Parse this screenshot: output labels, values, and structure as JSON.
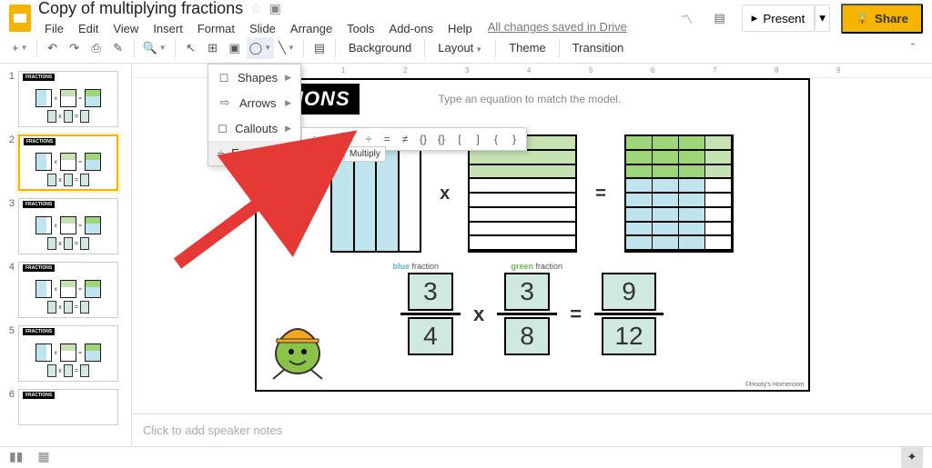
{
  "header": {
    "doc_title": "Copy of multiplying fractions",
    "saved_status": "All changes saved in Drive",
    "present_label": "Present",
    "share_label": "Share",
    "menus": [
      "File",
      "Edit",
      "View",
      "Insert",
      "Format",
      "Slide",
      "Arrange",
      "Tools",
      "Add-ons",
      "Help"
    ]
  },
  "toolbar": {
    "background": "Background",
    "layout": "Layout",
    "theme": "Theme",
    "transition": "Transition"
  },
  "shape_menu": {
    "items": [
      {
        "icon": "◻",
        "label": "Shapes"
      },
      {
        "icon": "→",
        "label": "Arrows"
      },
      {
        "icon": "▭",
        "label": "Callouts"
      },
      {
        "icon": "÷",
        "label": "Equation"
      }
    ]
  },
  "equation_submenu": [
    "÷",
    "−",
    "×",
    "÷",
    "=",
    "≠",
    "{}",
    "{}",
    "[",
    "]",
    "{",
    "}"
  ],
  "tooltip": "Multiply",
  "thumbs": {
    "title": "FRACTIONS",
    "slides": [
      {
        "n": "1",
        "eq": [
          "1",
          "4",
          "1",
          "3",
          "1",
          "12"
        ]
      },
      {
        "n": "2",
        "eq": [
          "3",
          "4",
          "3",
          "8",
          "9",
          "12"
        ],
        "selected": true
      },
      {
        "n": "3",
        "eq": [
          "",
          "",
          "",
          "",
          "",
          ""
        ]
      },
      {
        "n": "4",
        "eq": [
          "",
          "",
          "",
          "",
          "",
          ""
        ]
      },
      {
        "n": "5",
        "eq": [
          "",
          "",
          "",
          "",
          "",
          ""
        ]
      },
      {
        "n": "6",
        "eq": [
          "",
          "",
          "",
          "",
          "",
          ""
        ]
      }
    ]
  },
  "slide": {
    "title": "CTIONS",
    "prompt": "Type an equation to match the model.",
    "blue_label_1": "blue",
    "blue_label_2": " fraction",
    "green_label_1": "green",
    "green_label_2": " fraction",
    "op_times": "x",
    "op_equals": "=",
    "fractions": {
      "a_num": "3",
      "a_den": "4",
      "b_num": "3",
      "b_den": "8",
      "c_num": "9",
      "c_den": "12"
    },
    "credit": "©Hooty's Homeroom"
  },
  "notes": {
    "placeholder": "Click to add speaker notes"
  },
  "ruler_ticks": [
    "1",
    "2",
    "3",
    "4",
    "5",
    "6",
    "7",
    "8",
    "9"
  ]
}
